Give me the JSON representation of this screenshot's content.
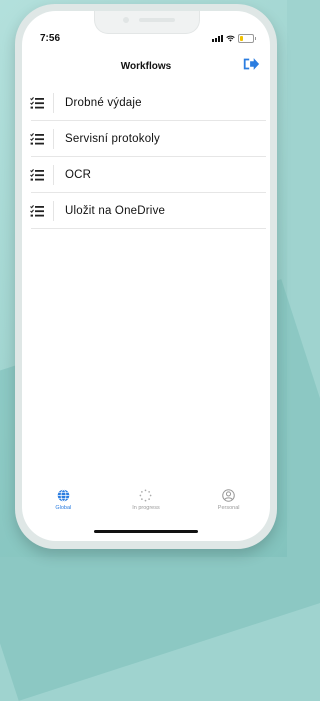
{
  "status": {
    "time": "7:56"
  },
  "header": {
    "title": "Workflows",
    "logout_icon": "logout-icon"
  },
  "workflows": [
    {
      "label": "Drobné výdaje",
      "icon": "checklist-icon"
    },
    {
      "label": "Servisní protokoly",
      "icon": "checklist-icon"
    },
    {
      "label": "OCR",
      "icon": "checklist-icon"
    },
    {
      "label": "Uložit na OneDrive",
      "icon": "checklist-icon"
    }
  ],
  "tabs": [
    {
      "label": "Global",
      "icon": "globe-icon",
      "active": true
    },
    {
      "label": "In progress",
      "icon": "spinner-icon",
      "active": false
    },
    {
      "label": "Personal",
      "icon": "user-icon",
      "active": false
    }
  ],
  "colors": {
    "accent": "#2b7de0",
    "background": "#9fd3cf"
  }
}
